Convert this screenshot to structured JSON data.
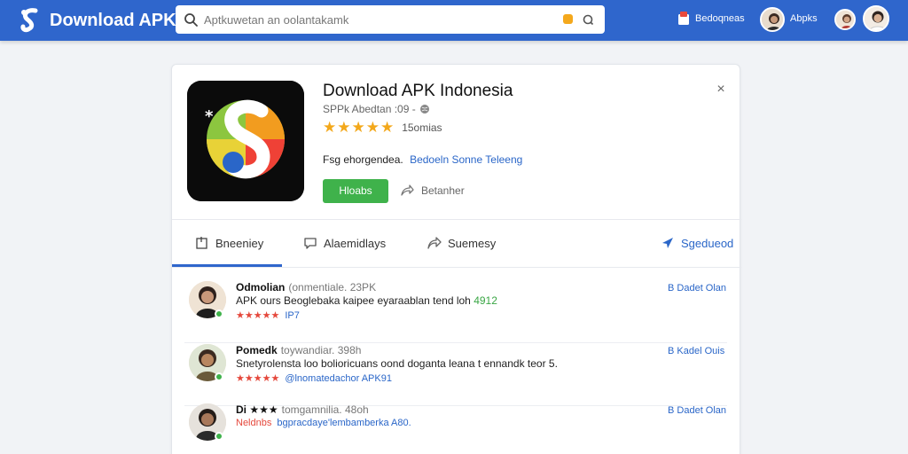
{
  "topbar": {
    "brand_name": "Download APK",
    "search_placeholder": "Aptkuwetan an oolantakamk",
    "notif_label": "Bedoqneas",
    "user_label": "Abpks"
  },
  "app": {
    "title": "Download APK Indonesia",
    "subtitle": "SPPk Abedtan :09 -",
    "rating_stars": "★★★★★",
    "rating_count": "15omias",
    "description": "Fsg ehorgendea.",
    "description_link": "Bedoeln Sonne Teleeng",
    "install_label": "Hloabs",
    "share_label": "Betanher",
    "close_glyph": "×"
  },
  "tabs": [
    {
      "label": "Bneeniey",
      "icon": "doc-icon"
    },
    {
      "label": "Alaemidlays",
      "icon": "comment-icon"
    },
    {
      "label": "Suemesy",
      "icon": "share-icon"
    },
    {
      "label": "Sgedueod",
      "icon": "send-icon"
    }
  ],
  "reviews": [
    {
      "name": "Odmolian",
      "meta": "(onmentiale. 23PK",
      "text": "APK ours Beoglebaka kaipee eyaraablan tend loh",
      "text_highlight": "4912",
      "stars": "★★★★★",
      "tag": "IP7",
      "action": "B Dadet Olan"
    },
    {
      "name": "Pomedk",
      "meta": "toywandiar. 398h",
      "text": "Snetyrolensta loo bolioricuans oond doganta leana t ennandk teor 5.",
      "text_highlight": "",
      "stars": "★★★★★",
      "tag": "@lnomatedachor APK91",
      "action": "B Kadel Ouis"
    },
    {
      "name": "Di ★★★",
      "meta": "tomgamnilia. 48oh",
      "text": "",
      "text_highlight": "",
      "stars": "Neldnbs",
      "tag": "bgpracdaye'lembamberka A80.",
      "action": "B Dadet Olan"
    }
  ],
  "colors": {
    "topbar": "#2f66cc",
    "install": "#3fb24b",
    "link": "#2a66c8",
    "star_gold": "#f3a81b",
    "star_red": "#e5483c"
  }
}
